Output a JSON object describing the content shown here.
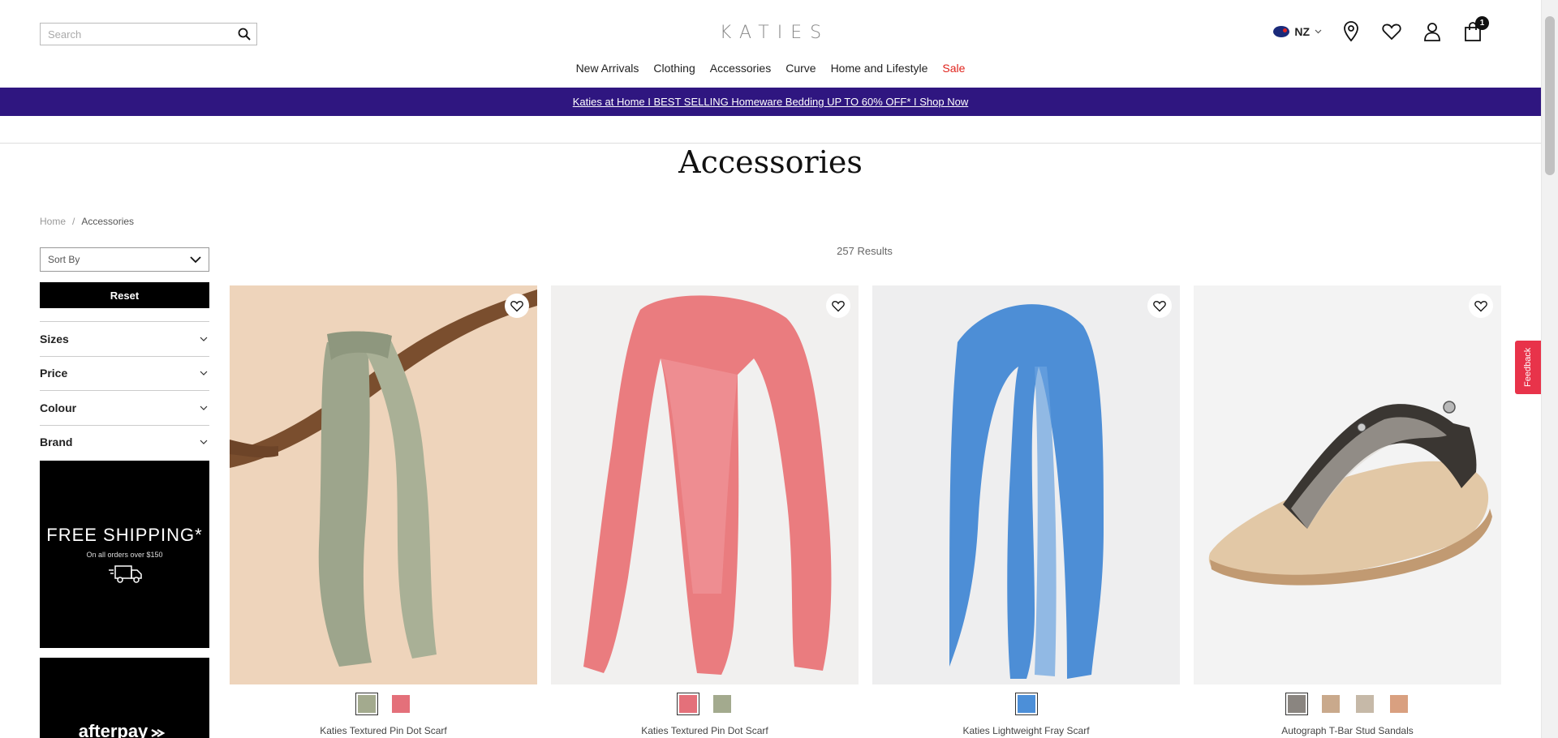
{
  "header": {
    "search_placeholder": "Search",
    "logo": "KATIES",
    "country": "NZ",
    "cart_count": "1",
    "icons": [
      "search-icon",
      "location-icon",
      "heart-icon",
      "user-icon",
      "bag-icon"
    ]
  },
  "nav": [
    {
      "label": "New Arrivals"
    },
    {
      "label": "Clothing"
    },
    {
      "label": "Accessories"
    },
    {
      "label": "Curve"
    },
    {
      "label": "Home and Lifestyle"
    },
    {
      "label": "Sale",
      "color": "#e0231c"
    }
  ],
  "promo": {
    "text": "Katies at Home I BEST SELLING Homeware Bedding UP TO 60% OFF* I Shop Now",
    "bg": "#2f1680"
  },
  "page_title": "Accessories",
  "breadcrumb": {
    "home": "Home",
    "sep": "/",
    "current": "Accessories"
  },
  "sidebar": {
    "sort_label": "Sort By",
    "reset_label": "Reset",
    "filters": [
      {
        "label": "Sizes"
      },
      {
        "label": "Price"
      },
      {
        "label": "Colour"
      },
      {
        "label": "Brand"
      }
    ],
    "shipping_banner": {
      "title": "FREE SHIPPING*",
      "subtitle": "On all orders over $150"
    },
    "afterpay_banner": {
      "text": "afterpay"
    }
  },
  "results_text": "257 Results",
  "products": [
    {
      "name": "Katies Textured Pin Dot Scarf",
      "swatches": [
        "#a3aa8e",
        "#e4707a"
      ]
    },
    {
      "name": "Katies Textured Pin Dot Scarf",
      "swatches": [
        "#e4707a",
        "#a3aa8e"
      ]
    },
    {
      "name": "Katies Lightweight Fray Scarf",
      "swatches": [
        "#4c8fd8"
      ]
    },
    {
      "name": "Autograph T-Bar Stud Sandals",
      "swatches": [
        "#8a8580",
        "#c9a98c",
        "#c6b9a8",
        "#d9a080"
      ]
    }
  ],
  "feedback_label": "Feedback"
}
